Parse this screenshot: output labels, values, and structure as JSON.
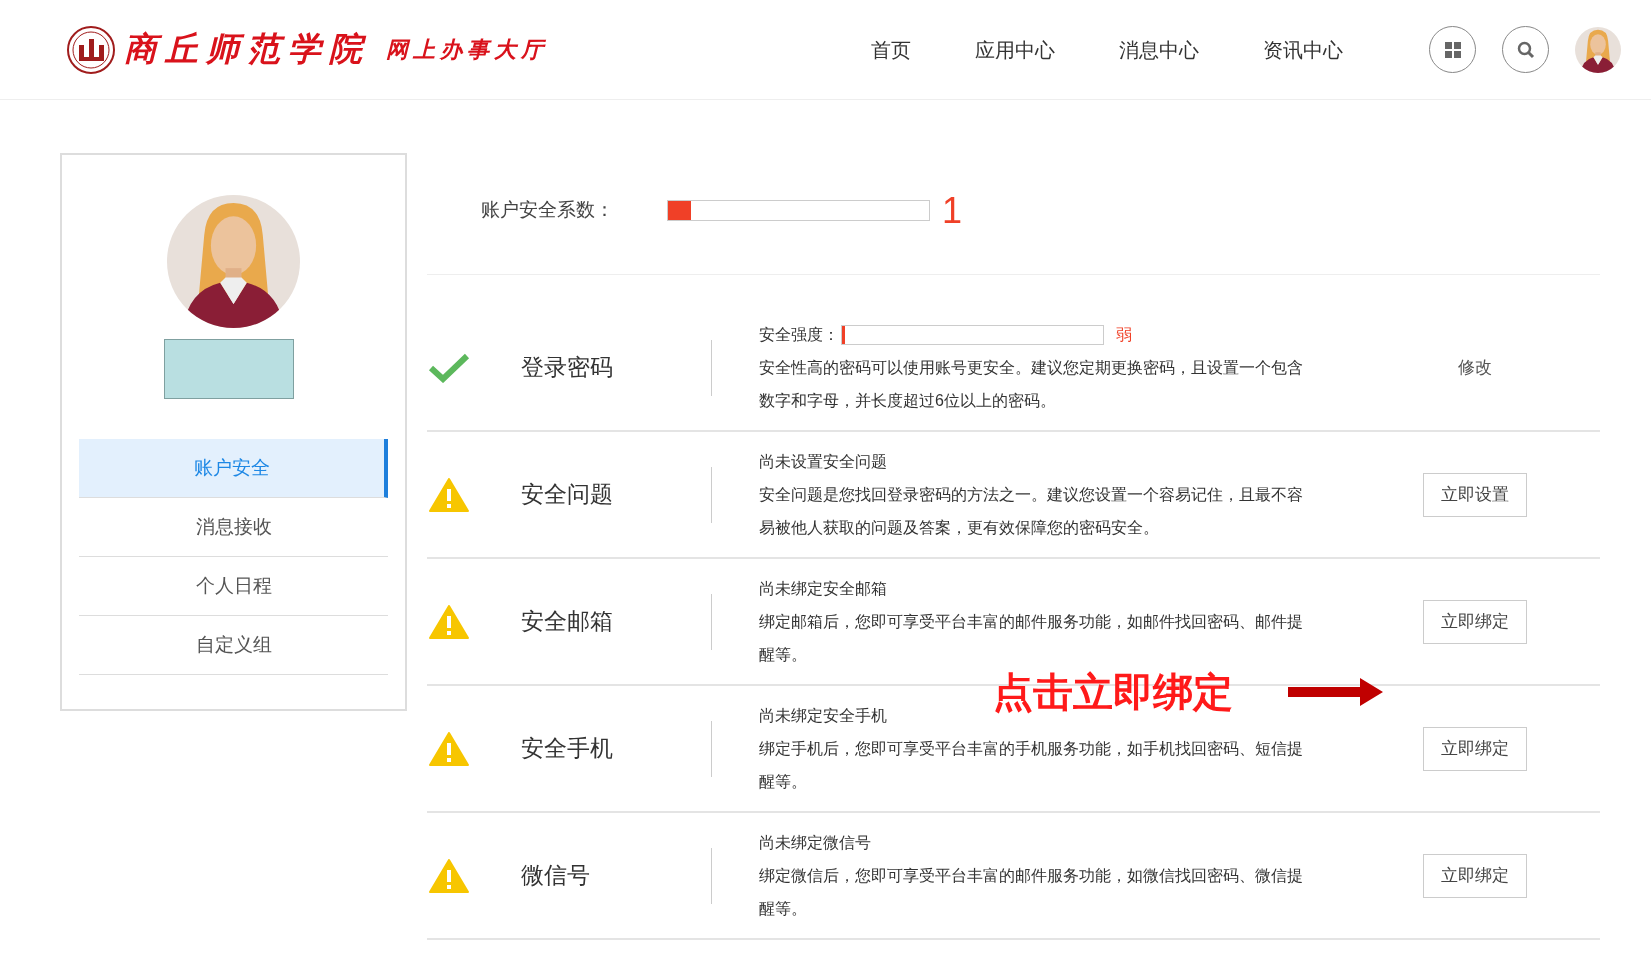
{
  "header": {
    "logo_title": "商丘师范学院",
    "logo_subtitle": "网上办事大厅",
    "nav": [
      {
        "label": "首页"
      },
      {
        "label": "应用中心"
      },
      {
        "label": "消息中心"
      },
      {
        "label": "资讯中心"
      }
    ]
  },
  "sidebar": {
    "items": [
      {
        "label": "账户安全",
        "selected": true
      },
      {
        "label": "消息接收",
        "selected": false
      },
      {
        "label": "个人日程",
        "selected": false
      },
      {
        "label": "自定义组",
        "selected": false
      }
    ]
  },
  "security_score": {
    "label": "账户安全系数：",
    "level": 0.09,
    "value": "1"
  },
  "items": [
    {
      "kind": "done",
      "title": "登录密码",
      "strength": {
        "label": "安全强度：",
        "level": 0.01,
        "reading": "弱"
      },
      "description": "安全性高的密码可以使用账号更安全。建议您定期更换密码，且设置一个包含数字和字母，并长度超过6位以上的密码。",
      "action": {
        "kind": "link",
        "label": "修改"
      }
    },
    {
      "kind": "warning",
      "title": "安全问题",
      "heading": "尚未设置安全问题",
      "description": "安全问题是您找回登录密码的方法之一。建议您设置一个容易记住，且最不容易被他人获取的问题及答案，更有效保障您的密码安全。",
      "action": {
        "kind": "button",
        "label": "立即设置"
      }
    },
    {
      "kind": "warning",
      "title": "安全邮箱",
      "heading": "尚未绑定安全邮箱",
      "description": "绑定邮箱后，您即可享受平台丰富的邮件服务功能，如邮件找回密码、邮件提醒等。",
      "action": {
        "kind": "button",
        "label": "立即绑定"
      },
      "annotation": "点击立即绑定"
    },
    {
      "kind": "warning",
      "title": "安全手机",
      "heading": "尚未绑定安全手机",
      "description": "绑定手机后，您即可享受平台丰富的手机服务功能，如手机找回密码、短信提醒等。",
      "action": {
        "kind": "button",
        "label": "立即绑定"
      }
    },
    {
      "kind": "warning",
      "title": "微信号",
      "heading": "尚未绑定微信号",
      "description": "绑定微信后，您即可享受平台丰富的邮件服务功能，如微信找回密码、微信提醒等。",
      "action": {
        "kind": "button",
        "label": "立即绑定"
      }
    }
  ]
}
